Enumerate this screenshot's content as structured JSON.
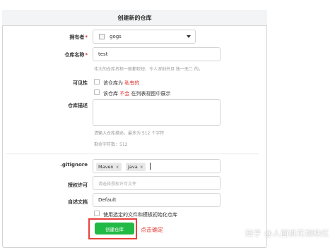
{
  "form": {
    "title": "创建新的仓库",
    "owner": {
      "label": "拥有者",
      "required_mark": "*",
      "value": "gogs"
    },
    "repo_name": {
      "label": "仓库名称",
      "required_mark": "*",
      "value": "test",
      "help": "伟大的仓库名称一般都较短、令人深刻并且 独一无二 的。"
    },
    "visibility": {
      "label": "可见性",
      "private_prefix": "该仓库为",
      "private_highlight": "私有的",
      "unlisted_prefix": "该仓库",
      "unlisted_highlight": "不会",
      "unlisted_suffix": "在列表视图中展示"
    },
    "description": {
      "label": "仓库描述",
      "value": "",
      "help": "请输入仓库描述，最多为 512 个字符",
      "remaining": "剩余字符数：512"
    },
    "gitignore": {
      "label": ".gitignore",
      "tags": [
        "Maven",
        "Java"
      ],
      "remove_glyph": "×"
    },
    "license": {
      "label": "授权许可",
      "placeholder": "请选择授权许可文件"
    },
    "readme": {
      "label": "自述文档",
      "value": "Default",
      "init_checkbox_label": "使用选定的文件和模板初始化仓库"
    },
    "submit_label": "创建仓库"
  },
  "annotation": {
    "text": "点击确定",
    "color": "#e8413c"
  },
  "watermark": "知乎 @人面桃花相映红",
  "colors": {
    "submit_green": "#21ba45",
    "required_red": "#db2828",
    "highlight_red": "#e8413c"
  }
}
